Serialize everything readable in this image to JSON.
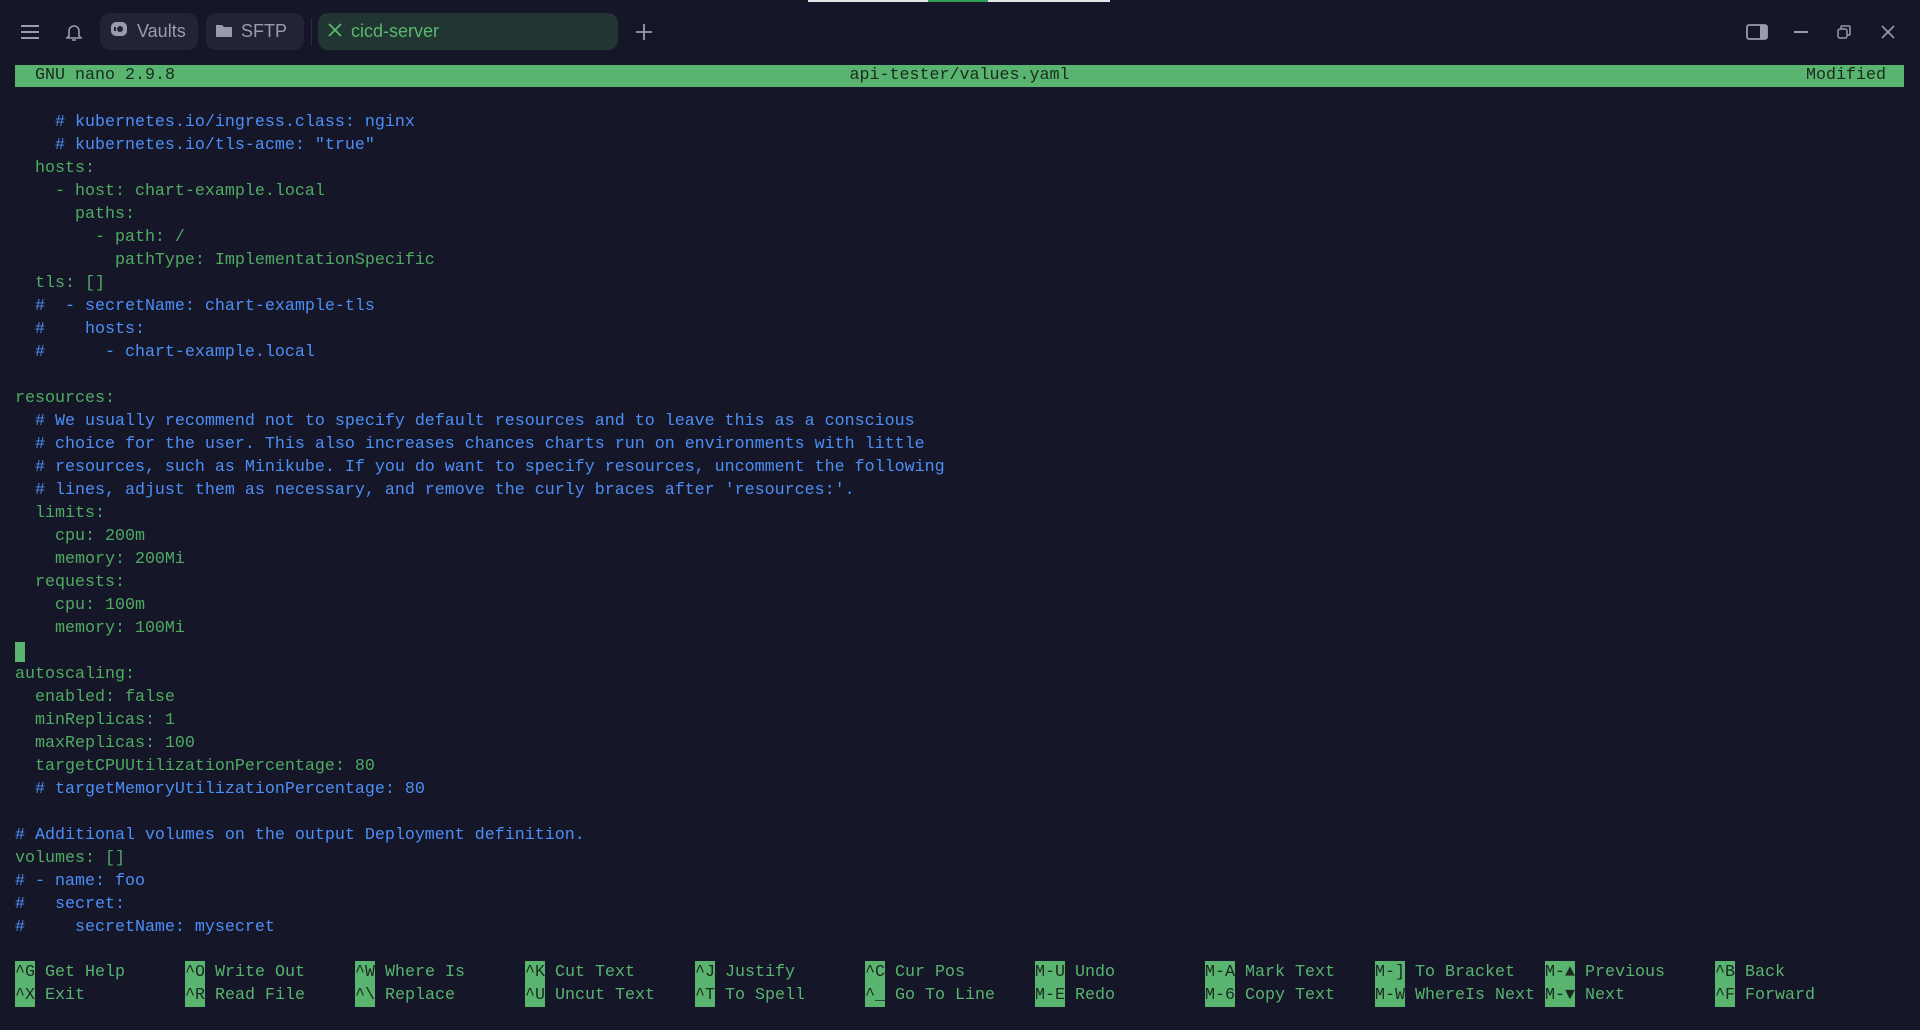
{
  "colors": {
    "background": "#151729",
    "accent_green": "#58b46f",
    "text_green": "#4faa62",
    "comment_blue": "#4d8ef5"
  },
  "header": {
    "tabs": [
      {
        "label": "Vaults",
        "icon": "vault-icon"
      },
      {
        "label": "SFTP",
        "icon": "folder-icon"
      },
      {
        "label": "cicd-server",
        "icon": "close-icon",
        "active": true
      }
    ]
  },
  "nano": {
    "version": "GNU nano 2.9.8",
    "filename": "api-tester/values.yaml",
    "status": "Modified",
    "lines": [
      {
        "text": "    # kubernetes.io/ingress.class: nginx",
        "comment": true
      },
      {
        "text": "    # kubernetes.io/tls-acme: \"true\"",
        "comment": true
      },
      {
        "text": "  hosts:",
        "comment": false
      },
      {
        "text": "    - host: chart-example.local",
        "comment": false
      },
      {
        "text": "      paths:",
        "comment": false
      },
      {
        "text": "        - path: /",
        "comment": false
      },
      {
        "text": "          pathType: ImplementationSpecific",
        "comment": false
      },
      {
        "text": "  tls: []",
        "comment": false
      },
      {
        "text": "  #  - secretName: chart-example-tls",
        "comment": true
      },
      {
        "text": "  #    hosts:",
        "comment": true
      },
      {
        "text": "  #      - chart-example.local",
        "comment": true
      },
      {
        "text": "",
        "comment": false
      },
      {
        "text": "resources:",
        "comment": false
      },
      {
        "text": "  # We usually recommend not to specify default resources and to leave this as a conscious",
        "comment": true
      },
      {
        "text": "  # choice for the user. This also increases chances charts run on environments with little",
        "comment": true
      },
      {
        "text": "  # resources, such as Minikube. If you do want to specify resources, uncomment the following",
        "comment": true
      },
      {
        "text": "  # lines, adjust them as necessary, and remove the curly braces after 'resources:'.",
        "comment": true
      },
      {
        "text": "  limits:",
        "comment": false
      },
      {
        "text": "    cpu: 200m",
        "comment": false
      },
      {
        "text": "    memory: 200Mi",
        "comment": false
      },
      {
        "text": "  requests:",
        "comment": false
      },
      {
        "text": "    cpu: 100m",
        "comment": false
      },
      {
        "text": "    memory: 100Mi",
        "comment": false
      },
      {
        "text": "",
        "comment": false,
        "cursor": true
      },
      {
        "text": "autoscaling:",
        "comment": false
      },
      {
        "text": "  enabled: false",
        "comment": false
      },
      {
        "text": "  minReplicas: 1",
        "comment": false
      },
      {
        "text": "  maxReplicas: 100",
        "comment": false
      },
      {
        "text": "  targetCPUUtilizationPercentage: 80",
        "comment": false
      },
      {
        "text": "  # targetMemoryUtilizationPercentage: 80",
        "comment": true
      },
      {
        "text": "",
        "comment": false
      },
      {
        "text": "# Additional volumes on the output Deployment definition.",
        "comment": true
      },
      {
        "text": "volumes: []",
        "comment": false
      },
      {
        "text": "# - name: foo",
        "comment": true
      },
      {
        "text": "#   secret:",
        "comment": true
      },
      {
        "text": "#     secretName: mysecret",
        "comment": true
      }
    ],
    "shortcuts": [
      [
        {
          "key": "^G",
          "label": "Get Help"
        },
        {
          "key": "^X",
          "label": "Exit"
        }
      ],
      [
        {
          "key": "^O",
          "label": "Write Out"
        },
        {
          "key": "^R",
          "label": "Read File"
        }
      ],
      [
        {
          "key": "^W",
          "label": "Where Is"
        },
        {
          "key": "^\\",
          "label": "Replace"
        }
      ],
      [
        {
          "key": "^K",
          "label": "Cut Text"
        },
        {
          "key": "^U",
          "label": "Uncut Text"
        }
      ],
      [
        {
          "key": "^J",
          "label": "Justify"
        },
        {
          "key": "^T",
          "label": "To Spell"
        }
      ],
      [
        {
          "key": "^C",
          "label": "Cur Pos"
        },
        {
          "key": "^_",
          "label": "Go To Line"
        }
      ],
      [
        {
          "key": "M-U",
          "label": "Undo"
        },
        {
          "key": "M-E",
          "label": "Redo"
        }
      ],
      [
        {
          "key": "M-A",
          "label": "Mark Text"
        },
        {
          "key": "M-6",
          "label": "Copy Text"
        }
      ],
      [
        {
          "key": "M-]",
          "label": "To Bracket"
        },
        {
          "key": "M-W",
          "label": "WhereIs Next"
        }
      ],
      [
        {
          "key": "M-▲",
          "label": "Previous"
        },
        {
          "key": "M-▼",
          "label": "Next"
        }
      ],
      [
        {
          "key": "^B",
          "label": "Back"
        },
        {
          "key": "^F",
          "label": "Forward"
        }
      ]
    ]
  }
}
